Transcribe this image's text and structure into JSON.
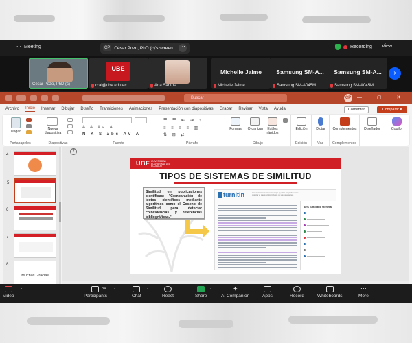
{
  "zoom": {
    "meeting_label": "Meeting",
    "share_initials": "CP",
    "share_title": "César Pozo, PhD (c)'s screen",
    "recording_label": "Recording",
    "view_label": "View",
    "participants": [
      {
        "name": "César Pozo, PhD (c)"
      },
      {
        "name": "crai@ube.edu.ec",
        "logo_text": "UBE"
      },
      {
        "name": "Ana Santos"
      },
      {
        "name": "Michelle Jaime",
        "big_name": "Michelle Jaime"
      },
      {
        "name": "Samsung SM-A045M",
        "big_name": "Samsung  SM-A..."
      },
      {
        "name": "Samsung SM-A045M",
        "big_name": "Samsung  SM-A..."
      }
    ],
    "toolbar": {
      "video": "Video",
      "participants": "Participants",
      "participants_count": "84",
      "chat": "Chat",
      "react": "React",
      "share": "Share",
      "ai_companion": "AI Companion",
      "apps": "Apps",
      "record": "Record",
      "whiteboards": "Whiteboards",
      "more": "More"
    },
    "accent_color": "#0b5cff",
    "share_color": "#23a455",
    "record_color": "#e0353d"
  },
  "powerpoint": {
    "search_placeholder": "Buscar",
    "avatar_initials": "CP",
    "menu": [
      "Archivo",
      "Inicio",
      "Insertar",
      "Dibujar",
      "Diseño",
      "Transiciones",
      "Animaciones",
      "Presentación con diapositivas",
      "Grabar",
      "Revisar",
      "Vista",
      "Ayuda"
    ],
    "active_menu": "Inicio",
    "comment_btn": "Comentar",
    "share_btn": "Compartir",
    "ribbon": {
      "groups": [
        "Portapapeles",
        "Diapositivas",
        "Fuente",
        "Párrafo",
        "Dibujo",
        "Edición",
        "Voz",
        "Complementos"
      ],
      "paste": "Pegar",
      "new_slide": "Nueva diapositiva",
      "shapes": "Formas",
      "arrange": "Organizar",
      "quick_styles": "Estilos rápidos",
      "editing": "Edición",
      "dictate": "Dictar",
      "addins": "Complementos",
      "designer": "Diseñador",
      "copilot": "Copilot"
    },
    "thumbnails": [
      {
        "num": "4"
      },
      {
        "num": "5"
      },
      {
        "num": "6"
      },
      {
        "num": "7"
      },
      {
        "num": "8",
        "text": "¡Muchas Gracias!"
      }
    ],
    "theme_color": "#b7472a",
    "slide": {
      "badge": "7",
      "logo": "UBE",
      "logo_sub": "UNIVERSIDAD BOLIVARIANA DEL ECUADOR",
      "title": "TIPOS DE SISTEMAS DE SIMILITUD",
      "textbox": "Similitud en publicaciones científicas: \"Comparación de textos científicos mediante algoritmos como el Coseno de Similitud para detectar coincidencias y referencias bibliográficas.\"",
      "turnitin": "turnitin",
      "turnitin_note": "Así una herramienta en línea que ayuda a los profesores a detectar el plagio en los trabajos de sus estudiantes.",
      "panel_title": "88% Similitud General",
      "accent_color": "#d11f26"
    }
  }
}
